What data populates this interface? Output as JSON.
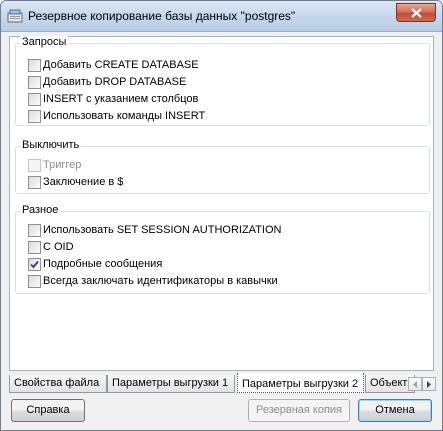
{
  "window": {
    "title": "Резервное копирование базы данных \"postgres\""
  },
  "groups": {
    "queries": {
      "title": "Запросы",
      "items": [
        {
          "label": "Добавить CREATE DATABASE",
          "checked": false,
          "disabled": false
        },
        {
          "label": "Добавить DROP DATABASE",
          "checked": false,
          "disabled": false
        },
        {
          "label": "INSERT с указанием столбцов",
          "checked": false,
          "disabled": false
        },
        {
          "label": "Использовать команды INSERT",
          "checked": false,
          "disabled": false
        }
      ]
    },
    "disable": {
      "title": "Выключить",
      "items": [
        {
          "label": "Триггер",
          "checked": false,
          "disabled": true
        },
        {
          "label": "Заключение в $",
          "checked": false,
          "disabled": false
        }
      ]
    },
    "misc": {
      "title": "Разное",
      "items": [
        {
          "label": "Использовать SET SESSION AUTHORIZATION",
          "checked": false,
          "disabled": false
        },
        {
          "label": "С OID",
          "checked": false,
          "disabled": false
        },
        {
          "label": "Подробные сообщения",
          "checked": true,
          "disabled": false
        },
        {
          "label": "Всегда заключать идентификаторы в кавычки",
          "checked": false,
          "disabled": false
        }
      ]
    }
  },
  "tabs": [
    {
      "label": "Свойства файла",
      "active": false
    },
    {
      "label": "Параметры выгрузки 1",
      "active": false
    },
    {
      "label": "Параметры выгрузки 2",
      "active": true
    },
    {
      "label": "Объекты",
      "active": false
    }
  ],
  "buttons": {
    "help": "Справка",
    "backup": "Резервная копия",
    "cancel": "Отмена"
  },
  "icons": {
    "app": "database-icon",
    "close": "close-icon",
    "tab_left": "arrow-left-icon",
    "tab_right": "arrow-right-icon",
    "check": "checkmark-icon"
  }
}
